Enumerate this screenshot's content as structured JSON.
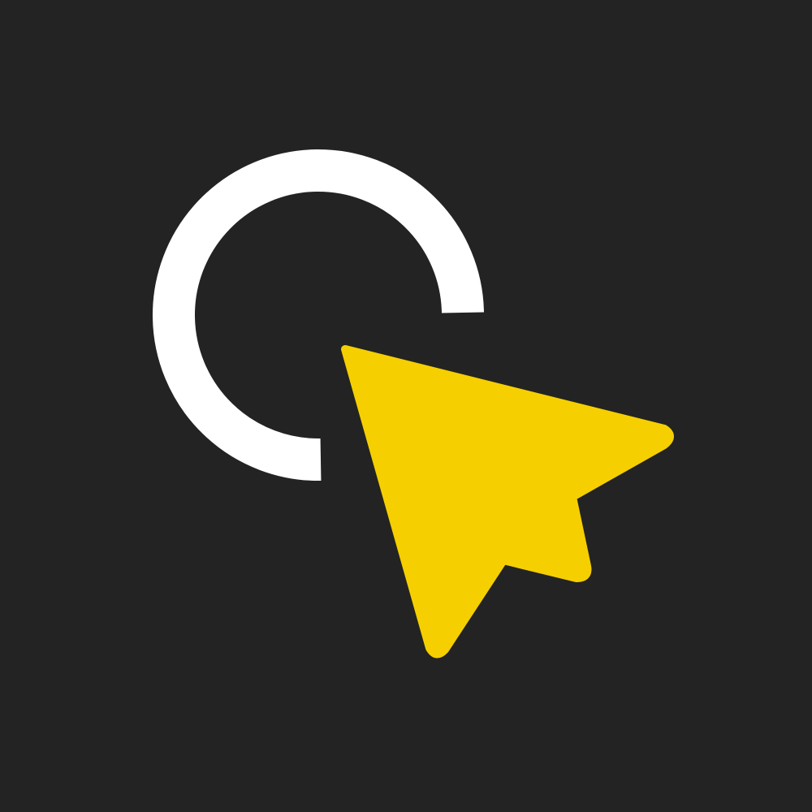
{
  "icon": {
    "name": "click-cursor-icon",
    "parts": {
      "ring": "circle-arc-icon",
      "pointer": "cursor-arrow-icon"
    }
  },
  "colors": {
    "background": "#232323",
    "ring": "#FFFFFF",
    "pointer": "#F5CF00"
  }
}
